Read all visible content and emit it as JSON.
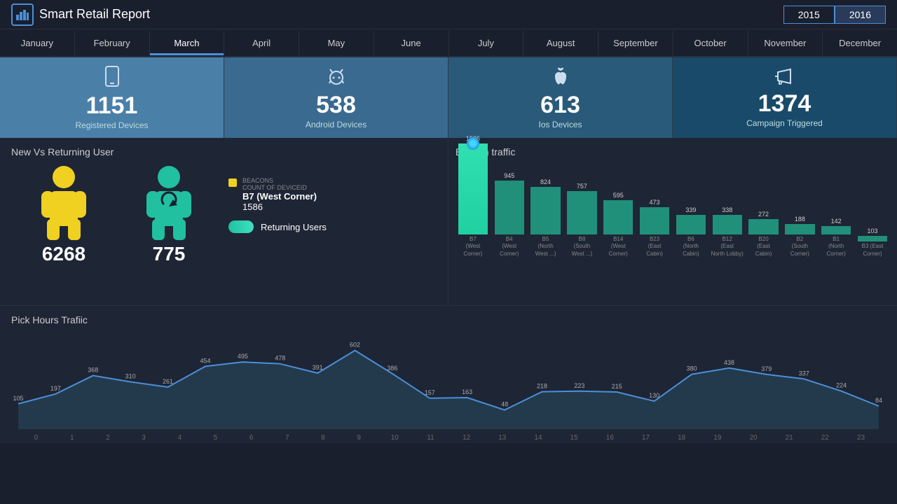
{
  "header": {
    "title": "Smart Retail Report",
    "logo_icon": "📊",
    "year_2015": "2015",
    "year_2016": "2016"
  },
  "months": [
    {
      "label": "January",
      "active": false
    },
    {
      "label": "February",
      "active": false
    },
    {
      "label": "March",
      "active": false
    },
    {
      "label": "April",
      "active": false
    },
    {
      "label": "May",
      "active": false
    },
    {
      "label": "June",
      "active": false
    },
    {
      "label": "July",
      "active": false
    },
    {
      "label": "August",
      "active": false
    },
    {
      "label": "September",
      "active": false
    },
    {
      "label": "October",
      "active": false
    },
    {
      "label": "November",
      "active": false
    },
    {
      "label": "December",
      "active": false
    }
  ],
  "stats": [
    {
      "icon": "📱",
      "value": "1151",
      "label": "Registered Devices"
    },
    {
      "icon": "🤖",
      "value": "538",
      "label": "Android Devices"
    },
    {
      "icon": "🍎",
      "value": "613",
      "label": "Ios Devices"
    },
    {
      "icon": "📢",
      "value": "1374",
      "label": "Campaign Triggered"
    }
  ],
  "new_vs_returning": {
    "title": "New Vs Returning User",
    "new_count": "6268",
    "returning_count": "775",
    "legend_beacons_label": "BEACONS",
    "legend_count_label": "COUNT OF DEVICEID",
    "beacon_name": "B7 (West Corner)",
    "beacon_count": "1586",
    "returning_users_label": "Returning Users"
  },
  "beacon_traffic": {
    "title": "Beacon traffic",
    "bars": [
      {
        "label": "1586",
        "name": "B7\n(West\nCorner)",
        "value": 1586,
        "highlighted": true
      },
      {
        "label": "945",
        "name": "B4\n(West\nCorner)",
        "value": 945
      },
      {
        "label": "824",
        "name": "B5\n(North\nWest ...)",
        "value": 824
      },
      {
        "label": "757",
        "name": "B8\n(South\nWest ...)",
        "value": 757
      },
      {
        "label": "595",
        "name": "B14\n(West\nCorner)",
        "value": 595
      },
      {
        "label": "473",
        "name": "B23\n(East\nCabin)",
        "value": 473
      },
      {
        "label": "339",
        "name": "B6\n(North\nCabin)",
        "value": 339
      },
      {
        "label": "338",
        "name": "B12\n(East\nNorth Lobby)",
        "value": 338
      },
      {
        "label": "272",
        "name": "B20\n(East\nCabin)",
        "value": 272
      },
      {
        "label": "188",
        "name": "B2\n(South\nCorner)",
        "value": 188
      },
      {
        "label": "142",
        "name": "B1\n(North\nCorner)",
        "value": 142
      },
      {
        "label": "103",
        "name": "B3 (East\nCorner)",
        "value": 103
      }
    ],
    "max_value": 1586
  },
  "pick_hours": {
    "title": "Pick Hours Trafiic",
    "data": [
      105,
      197,
      368,
      310,
      261,
      454,
      495,
      478,
      391,
      602,
      386,
      157,
      163,
      48,
      218,
      223,
      215,
      130,
      380,
      438,
      379,
      337,
      224,
      84
    ],
    "x_labels": [
      "0",
      "1",
      "2",
      "3",
      "4",
      "5",
      "6",
      "7",
      "8",
      "9",
      "10",
      "11",
      "12",
      "13",
      "14",
      "15",
      "16",
      "17",
      "18",
      "19",
      "20",
      "21",
      "22",
      "23"
    ]
  }
}
